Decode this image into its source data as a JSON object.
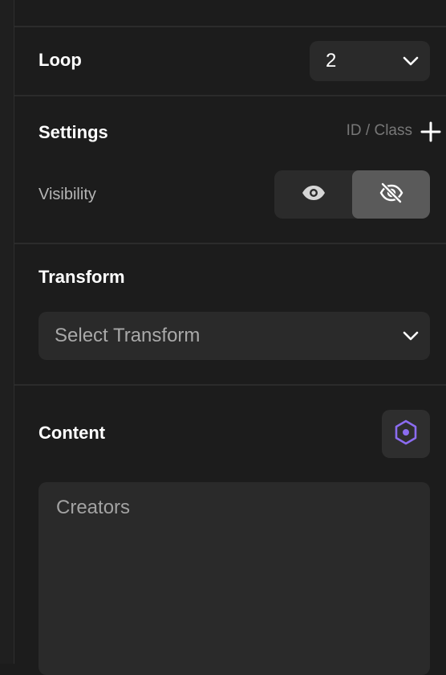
{
  "loop": {
    "label": "Loop",
    "value": "2"
  },
  "settings": {
    "title": "Settings",
    "id_class_label": "ID / Class",
    "visibility_label": "Visibility",
    "visibility_state": "hidden"
  },
  "transform": {
    "title": "Transform",
    "placeholder": "Select Transform"
  },
  "content": {
    "title": "Content",
    "text": "Creators"
  },
  "colors": {
    "accent": "#8b6cf0"
  }
}
